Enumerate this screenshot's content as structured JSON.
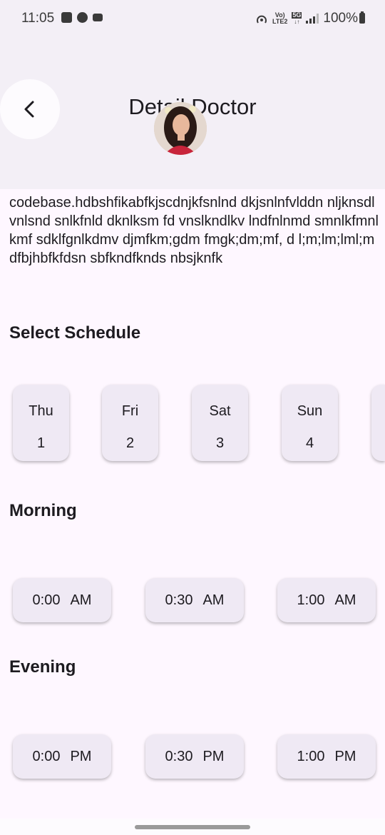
{
  "status_bar": {
    "time": "11:05",
    "network_top": "Vo)",
    "network_bottom": "LTE2",
    "fiveg": "5G",
    "battery_pct": "100%",
    "icons": [
      "image-icon",
      "app-icon",
      "video-icon",
      "hotspot-icon",
      "signal-icon",
      "battery-icon"
    ]
  },
  "header": {
    "title": "Detail Doctor",
    "back_icon": "chevron-left-icon"
  },
  "description": "codebase.hdbshfikabfkjscdnjkfsnlnd dkjsnlnfvlddn nljknsdlvnlsnd snlkfnld dknlksm fd vnslkndlkv lndfnlnmd smnlkfmnlkmf sdklfgnlkdmv djmfkm;gdm fmgk;dm;mf, d l;m;lm;lml;mdfbjhbfkfdsn sbfkndfknds nbsjknfk",
  "schedule": {
    "title": "Select Schedule",
    "days": [
      {
        "name": "Thu",
        "date": "1"
      },
      {
        "name": "Fri",
        "date": "2"
      },
      {
        "name": "Sat",
        "date": "3"
      },
      {
        "name": "Sun",
        "date": "4"
      }
    ]
  },
  "morning": {
    "title": "Morning",
    "slots": [
      {
        "time": "0:00",
        "period": "AM"
      },
      {
        "time": "0:30",
        "period": "AM"
      },
      {
        "time": "1:00",
        "period": "AM"
      }
    ]
  },
  "evening": {
    "title": "Evening",
    "slots": [
      {
        "time": "0:00",
        "period": "PM"
      },
      {
        "time": "0:30",
        "period": "PM"
      },
      {
        "time": "1:00",
        "period": "PM"
      }
    ]
  },
  "colors": {
    "background": "#fef7ff",
    "header_bg": "#f3eff6",
    "chip_bg": "#efe9f4",
    "text": "#1d1b20"
  }
}
